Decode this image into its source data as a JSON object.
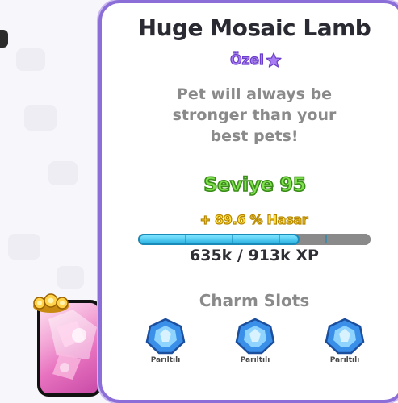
{
  "pet": {
    "name": "Huge Mosaic Lamb",
    "rarity": "Özel",
    "description": "Pet will always be stronger than your best pets!",
    "level_text": "Seviye 95",
    "damage_bonus": "+ 89.6 % Hasar",
    "xp_text": "635k / 913k XP",
    "xp_progress": 0.696
  },
  "charms": {
    "title": "Charm Slots",
    "slots": [
      {
        "label": "Parıltılı",
        "icon": "blue-gem-icon"
      },
      {
        "label": "Parıltılı",
        "icon": "blue-gem-icon"
      },
      {
        "label": "Parıltılı",
        "icon": "blue-gem-icon"
      }
    ]
  },
  "colors": {
    "panel_border": "#8c6ed8",
    "rarity": "#a97df2",
    "level": "#7ee04d",
    "damage": "#ffe24a",
    "xp_fill": "#2bb3e3",
    "charm_gem": "#3a8fe8"
  }
}
